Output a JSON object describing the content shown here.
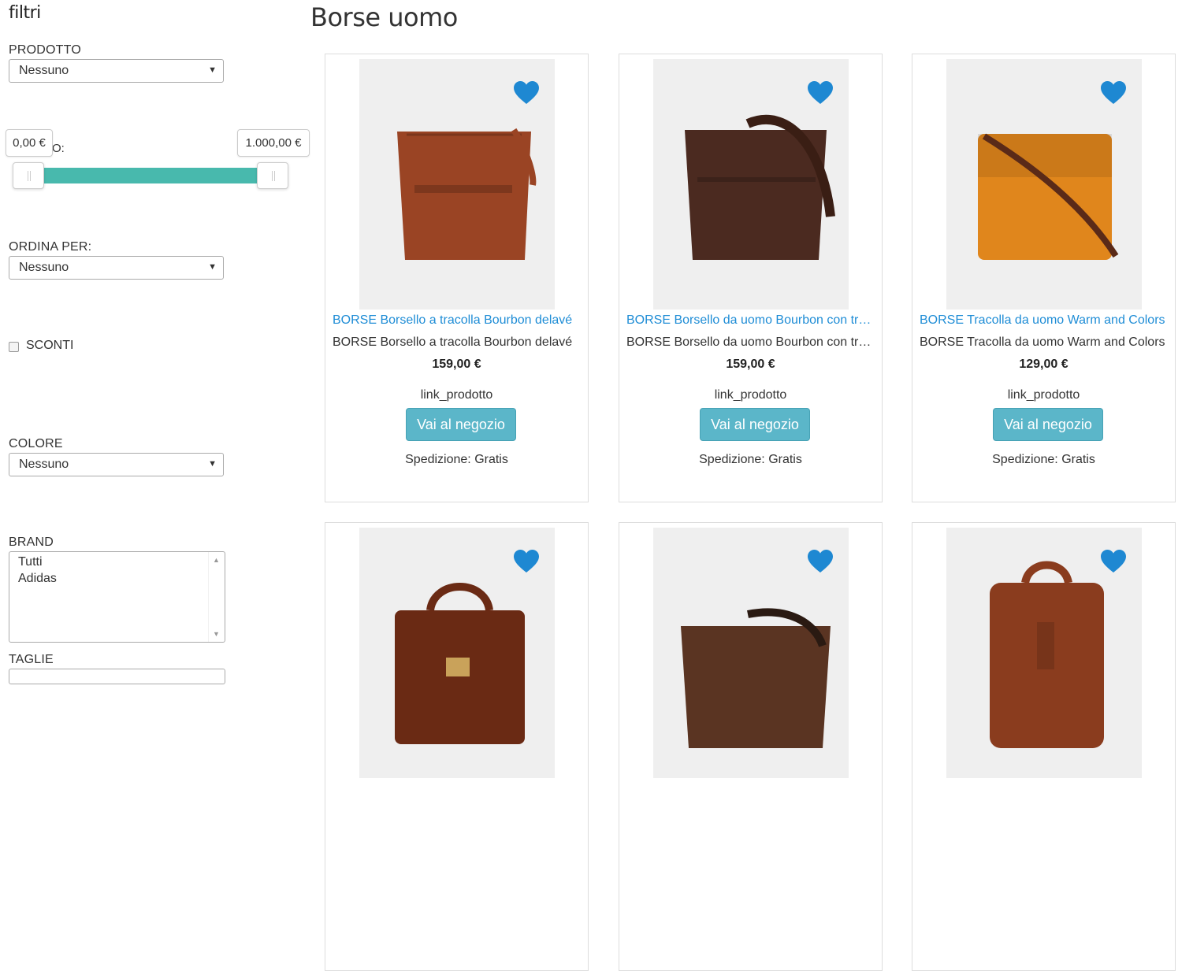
{
  "sidebar": {
    "title": "filtri",
    "prodotto": {
      "label": "PRODOTTO",
      "value": "Nessuno"
    },
    "prezzo": {
      "label_fragment": "O:",
      "min": "0,00 €",
      "max": "1.000,00 €"
    },
    "ordina": {
      "label": "ORDINA PER:",
      "value": "Nessuno"
    },
    "sconti": {
      "label": "SCONTI",
      "checked": false
    },
    "colore": {
      "label": "COLORE",
      "value": "Nessuno"
    },
    "brand": {
      "label": "BRAND",
      "options": [
        "Tutti",
        "Adidas"
      ]
    },
    "taglie": {
      "label": "TAGLIE"
    }
  },
  "main": {
    "title": "Borse uomo",
    "products": [
      {
        "name": "BORSE Borsello a tracolla Bourbon delavé",
        "price": "159,00 €",
        "link_label": "link_prodotto",
        "button": "Vai al negozio",
        "shipping": "Spedizione: Gratis",
        "color": "#9a4424"
      },
      {
        "name": "BORSE Borsello da uomo Bourbon con tracolla",
        "price": "159,00 €",
        "link_label": "link_prodotto",
        "button": "Vai al negozio",
        "shipping": "Spedizione: Gratis",
        "color": "#4b2a20"
      },
      {
        "name": "BORSE Tracolla da uomo Warm and Colors",
        "price": "129,00 €",
        "link_label": "link_prodotto",
        "button": "Vai al negozio",
        "shipping": "Spedizione: Gratis",
        "color": "#e0861c"
      },
      {
        "color": "#6a2a14"
      },
      {
        "color": "#5a3422"
      },
      {
        "color": "#8a3c1e"
      }
    ]
  },
  "colors": {
    "accent": "#5bb6c9",
    "link": "#1f8dd6",
    "slider": "#48b9ad",
    "heart": "#1e88d2"
  }
}
